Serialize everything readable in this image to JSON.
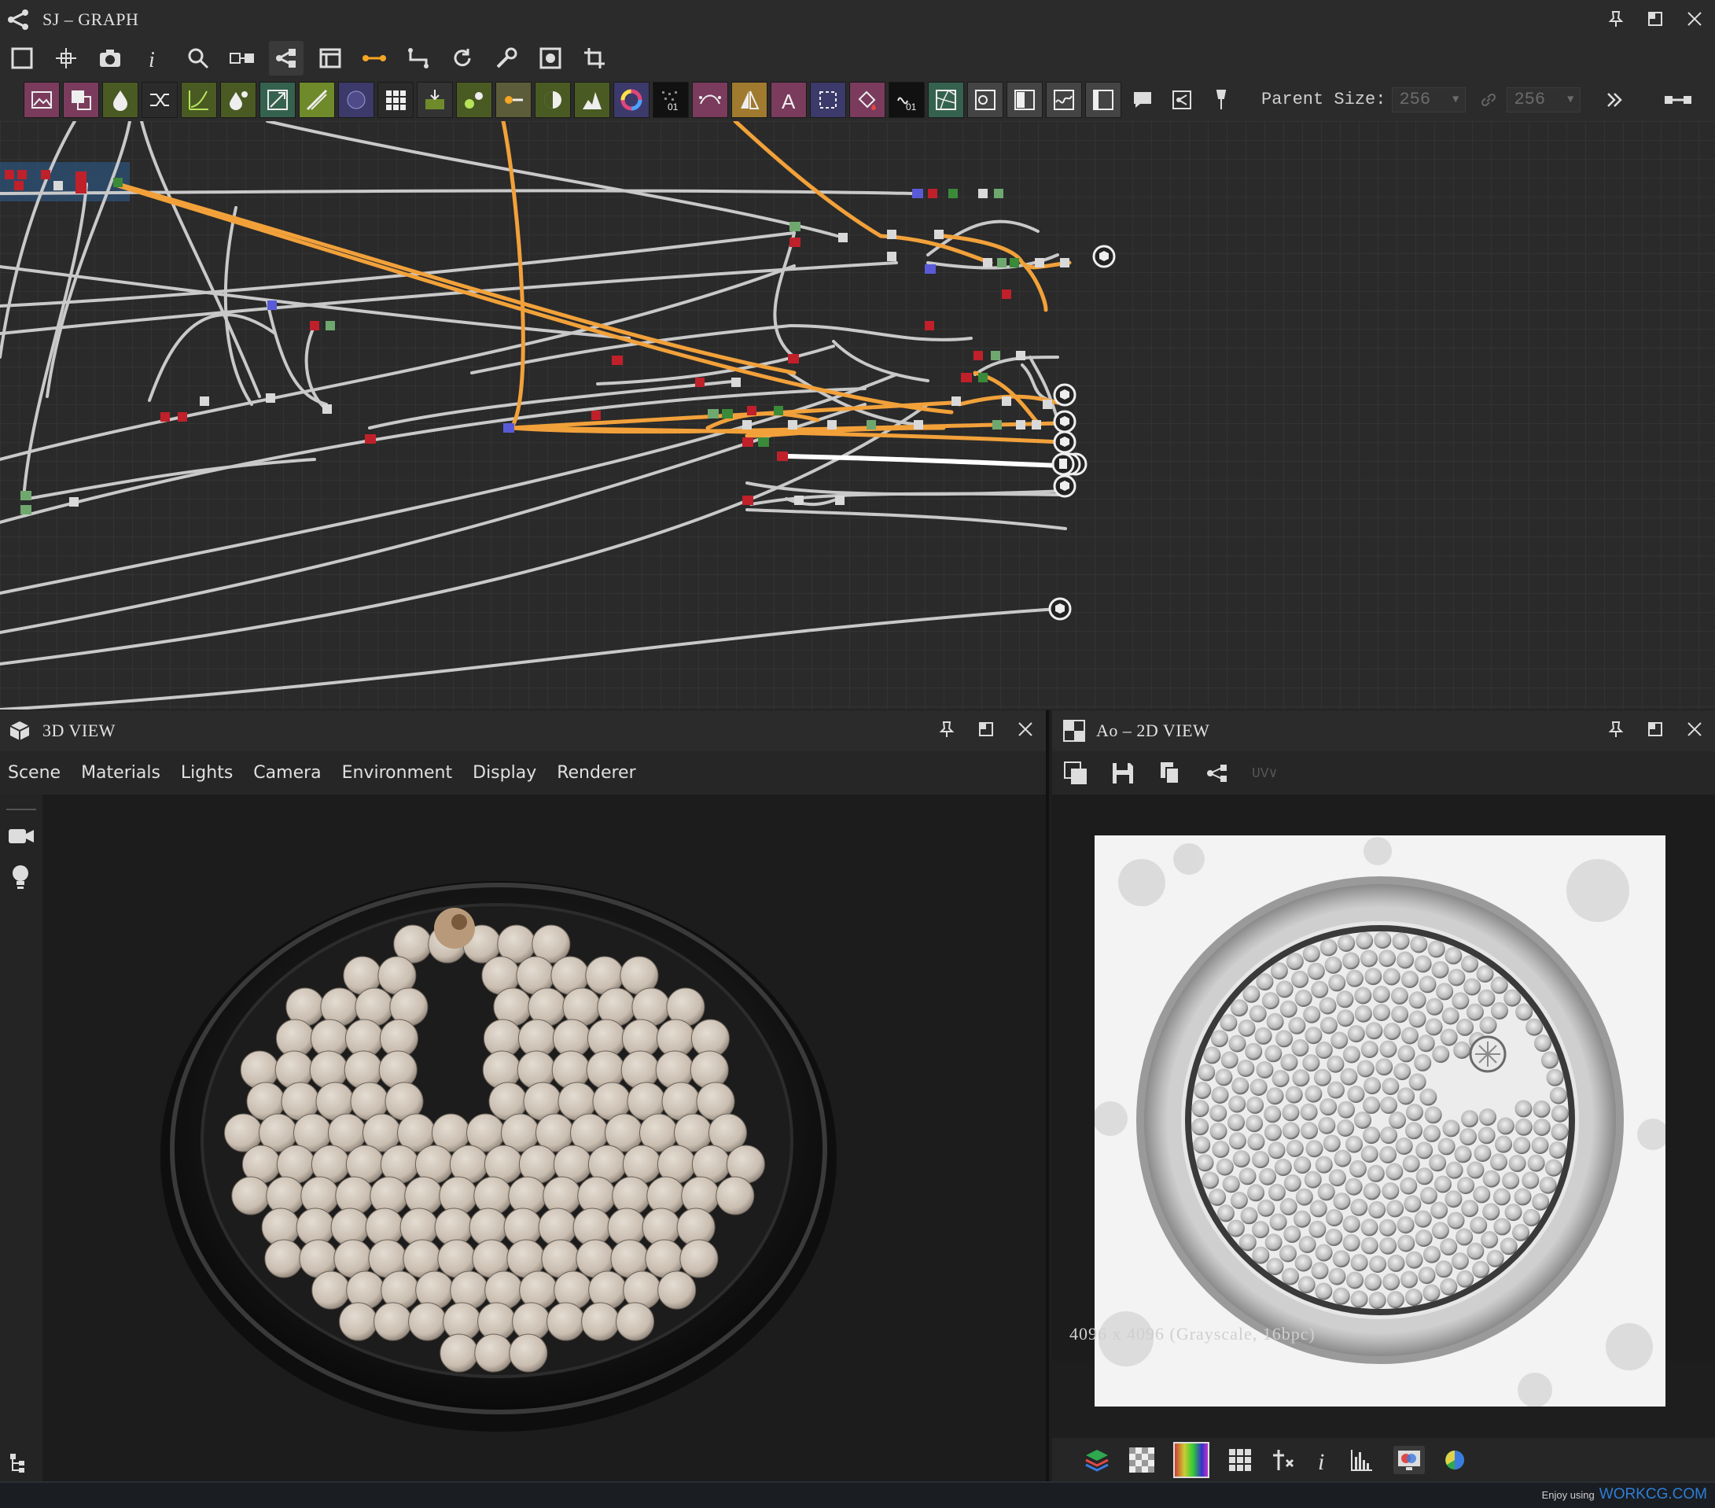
{
  "graph": {
    "title": "SJ – GRAPH",
    "parent_size_label": "Parent Size:",
    "parent_size_w": "256",
    "parent_size_h": "256"
  },
  "view3d": {
    "title": "3D VIEW",
    "menu": [
      "Scene",
      "Materials",
      "Lights",
      "Camera",
      "Environment",
      "Display",
      "Renderer"
    ]
  },
  "view2d": {
    "title": "Ao – 2D VIEW",
    "uv_label": "UV",
    "resolution": "4096 x 4096 (Grayscale, 16bpc)"
  },
  "footer": {
    "prefix": "Enjoy using",
    "brand": "WORKCG.COM"
  },
  "icons": {
    "title": "graph-icon",
    "toolbar1": [
      "frame-icon",
      "fit-icon",
      "camera-icon",
      "info-icon",
      "search-icon",
      "align-icon",
      "graph-icon",
      "layout-icon",
      "connector-icon",
      "path-icon",
      "refresh-icon",
      "wrench-icon",
      "preview-icon",
      "crop-icon"
    ]
  }
}
